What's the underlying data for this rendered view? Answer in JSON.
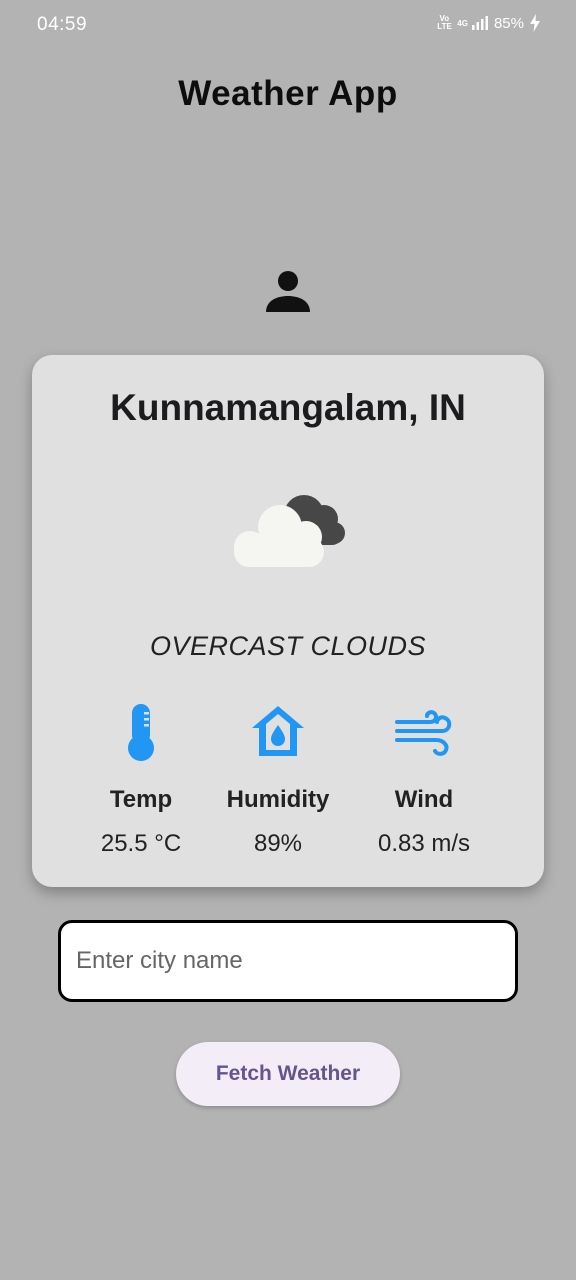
{
  "status_bar": {
    "time": "04:59",
    "volte": "Vo LTE",
    "network": "4G",
    "battery": "85%",
    "icons": [
      "volte-icon",
      "signal-icon",
      "battery-charging-icon"
    ]
  },
  "app": {
    "title": "Weather App"
  },
  "weather": {
    "city": "Kunnamangalam, IN",
    "description": "OVERCAST CLOUDS",
    "icon": "overcast-clouds-icon",
    "stats": {
      "temp": {
        "label": "Temp",
        "value": "25.5 °C",
        "icon": "thermometer-icon"
      },
      "humidity": {
        "label": "Humidity",
        "value": "89%",
        "icon": "humidity-house-icon"
      },
      "wind": {
        "label": "Wind",
        "value": "0.83 m/s",
        "icon": "wind-icon"
      }
    }
  },
  "search": {
    "placeholder": "Enter city name",
    "value": ""
  },
  "actions": {
    "fetch_label": "Fetch Weather"
  },
  "colors": {
    "background": "#b3b3b3",
    "card": "#e0e0e0",
    "accent_icon": "#2196f3",
    "button_bg": "#f3edf7",
    "button_text": "#65558f"
  }
}
